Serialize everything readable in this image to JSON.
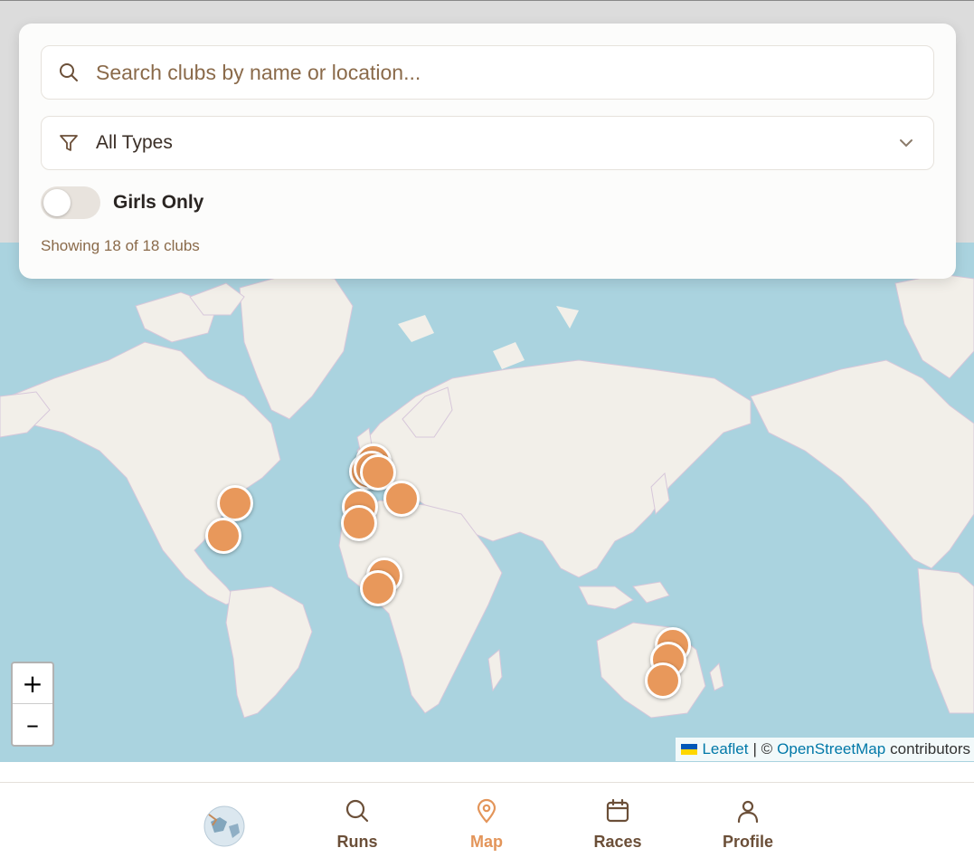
{
  "search": {
    "placeholder": "Search clubs by name or location..."
  },
  "filter": {
    "selected": "All Types"
  },
  "toggle": {
    "label": "Girls Only",
    "on": false
  },
  "status": {
    "count_text": "Showing 18 of 18 clubs"
  },
  "map": {
    "zoom_in": "+",
    "zoom_out": "–",
    "attribution": {
      "leaflet": "Leaflet",
      "separator": "| ©",
      "osm": "OpenStreetMap",
      "suffix": "contributors"
    },
    "marker_color": "#e8985b"
  },
  "nav": {
    "items": [
      {
        "label": "Runs",
        "icon": "search-icon",
        "active": false
      },
      {
        "label": "Map",
        "icon": "map-pin-icon",
        "active": true
      },
      {
        "label": "Races",
        "icon": "calendar-icon",
        "active": false
      },
      {
        "label": "Profile",
        "icon": "user-icon",
        "active": false
      }
    ],
    "active_color": "#e3955a",
    "inactive_color": "#6b4f38"
  }
}
